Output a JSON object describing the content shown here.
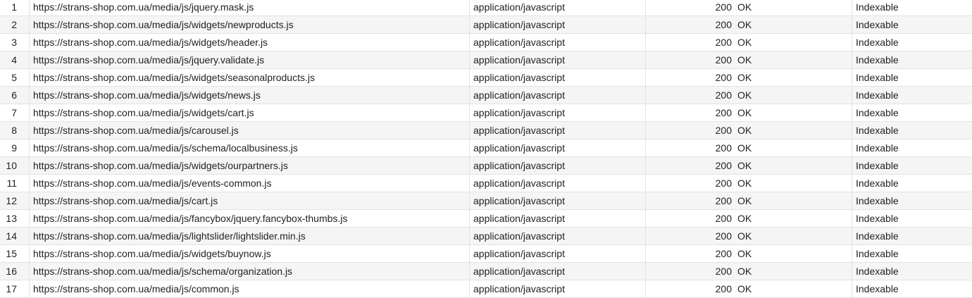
{
  "table": {
    "rows": [
      {
        "num": "1",
        "address": "https://strans-shop.com.ua/media/js/jquery.mask.js",
        "content_type": "application/javascript",
        "status_code": "200",
        "status": "OK",
        "indexability": "Indexable"
      },
      {
        "num": "2",
        "address": "https://strans-shop.com.ua/media/js/widgets/newproducts.js",
        "content_type": "application/javascript",
        "status_code": "200",
        "status": "OK",
        "indexability": "Indexable"
      },
      {
        "num": "3",
        "address": "https://strans-shop.com.ua/media/js/widgets/header.js",
        "content_type": "application/javascript",
        "status_code": "200",
        "status": "OK",
        "indexability": "Indexable"
      },
      {
        "num": "4",
        "address": "https://strans-shop.com.ua/media/js/jquery.validate.js",
        "content_type": "application/javascript",
        "status_code": "200",
        "status": "OK",
        "indexability": "Indexable"
      },
      {
        "num": "5",
        "address": "https://strans-shop.com.ua/media/js/widgets/seasonalproducts.js",
        "content_type": "application/javascript",
        "status_code": "200",
        "status": "OK",
        "indexability": "Indexable"
      },
      {
        "num": "6",
        "address": "https://strans-shop.com.ua/media/js/widgets/news.js",
        "content_type": "application/javascript",
        "status_code": "200",
        "status": "OK",
        "indexability": "Indexable"
      },
      {
        "num": "7",
        "address": "https://strans-shop.com.ua/media/js/widgets/cart.js",
        "content_type": "application/javascript",
        "status_code": "200",
        "status": "OK",
        "indexability": "Indexable"
      },
      {
        "num": "8",
        "address": "https://strans-shop.com.ua/media/js/carousel.js",
        "content_type": "application/javascript",
        "status_code": "200",
        "status": "OK",
        "indexability": "Indexable"
      },
      {
        "num": "9",
        "address": "https://strans-shop.com.ua/media/js/schema/localbusiness.js",
        "content_type": "application/javascript",
        "status_code": "200",
        "status": "OK",
        "indexability": "Indexable"
      },
      {
        "num": "10",
        "address": "https://strans-shop.com.ua/media/js/widgets/ourpartners.js",
        "content_type": "application/javascript",
        "status_code": "200",
        "status": "OK",
        "indexability": "Indexable"
      },
      {
        "num": "11",
        "address": "https://strans-shop.com.ua/media/js/events-common.js",
        "content_type": "application/javascript",
        "status_code": "200",
        "status": "OK",
        "indexability": "Indexable"
      },
      {
        "num": "12",
        "address": "https://strans-shop.com.ua/media/js/cart.js",
        "content_type": "application/javascript",
        "status_code": "200",
        "status": "OK",
        "indexability": "Indexable"
      },
      {
        "num": "13",
        "address": "https://strans-shop.com.ua/media/js/fancybox/jquery.fancybox-thumbs.js",
        "content_type": "application/javascript",
        "status_code": "200",
        "status": "OK",
        "indexability": "Indexable"
      },
      {
        "num": "14",
        "address": "https://strans-shop.com.ua/media/js/lightslider/lightslider.min.js",
        "content_type": "application/javascript",
        "status_code": "200",
        "status": "OK",
        "indexability": "Indexable"
      },
      {
        "num": "15",
        "address": "https://strans-shop.com.ua/media/js/widgets/buynow.js",
        "content_type": "application/javascript",
        "status_code": "200",
        "status": "OK",
        "indexability": "Indexable"
      },
      {
        "num": "16",
        "address": "https://strans-shop.com.ua/media/js/schema/organization.js",
        "content_type": "application/javascript",
        "status_code": "200",
        "status": "OK",
        "indexability": "Indexable"
      },
      {
        "num": "17",
        "address": "https://strans-shop.com.ua/media/js/common.js",
        "content_type": "application/javascript",
        "status_code": "200",
        "status": "OK",
        "indexability": "Indexable"
      }
    ]
  }
}
